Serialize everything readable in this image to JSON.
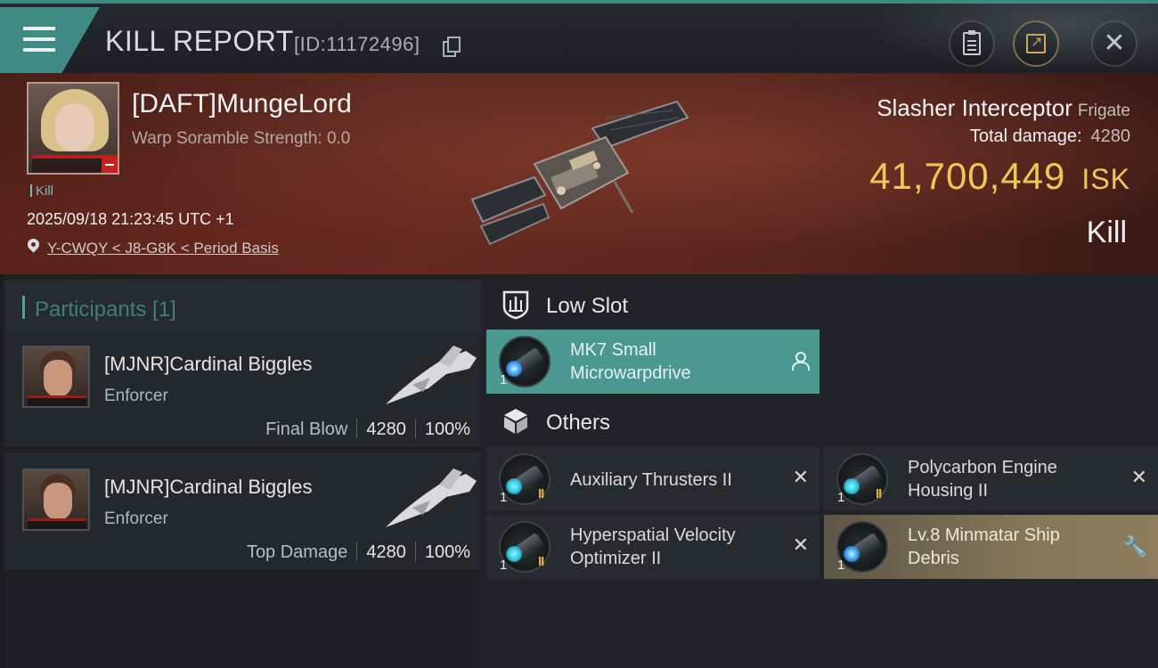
{
  "header": {
    "title": "KILL REPORT",
    "report_id": "[ID:11172496]"
  },
  "victim": {
    "name": "[DAFT]MungeLord",
    "warp_scramble": "Warp Soramble Strength: 0.0",
    "kill_count": "Kill",
    "timestamp": "2025/09/18 21:23:45 UTC +1",
    "location": "Y-CWQY < J8-G8K < Period Basis",
    "ship_name": "Slasher Interceptor",
    "ship_class": "Frigate",
    "total_damage_label": "Total damage:",
    "total_damage_value": "4280",
    "isk_value": "41,700,449",
    "isk_unit": "ISK",
    "result": "Kill"
  },
  "participants": {
    "header": "Participants [1]",
    "items": [
      {
        "name": "[MJNR]Cardinal Biggles",
        "ship": "Enforcer",
        "role": "Final Blow",
        "damage": "4280",
        "percent": "100%"
      },
      {
        "name": "[MJNR]Cardinal Biggles",
        "ship": "Enforcer",
        "role": "Top Damage",
        "damage": "4280",
        "percent": "100%"
      }
    ]
  },
  "modules": {
    "low_slot_title": "Low Slot",
    "others_title": "Others",
    "low_slot": [
      {
        "line1": "MK7 Small",
        "line2": "Microwarpdrive",
        "qty": "1",
        "status": "person-icon"
      }
    ],
    "others": [
      {
        "line1": "Auxiliary Thrusters II",
        "line2": "",
        "qty": "1",
        "tier": "II",
        "status": "destroyed"
      },
      {
        "line1": "Polycarbon Engine",
        "line2": "Housing II",
        "qty": "1",
        "tier": "II",
        "status": "destroyed"
      },
      {
        "line1": "Hyperspatial Velocity",
        "line2": "Optimizer II",
        "qty": "1",
        "tier": "II",
        "status": "destroyed"
      },
      {
        "line1": "Lv.8 Minmatar Ship",
        "line2": "Debris",
        "qty": "1",
        "tier": "",
        "status": "wrench-icon"
      }
    ]
  },
  "colors": {
    "accent": "#3f8a82",
    "isk": "#f0c659",
    "low_slot_bg": "#4a9890",
    "debris_bg": "#847658"
  }
}
